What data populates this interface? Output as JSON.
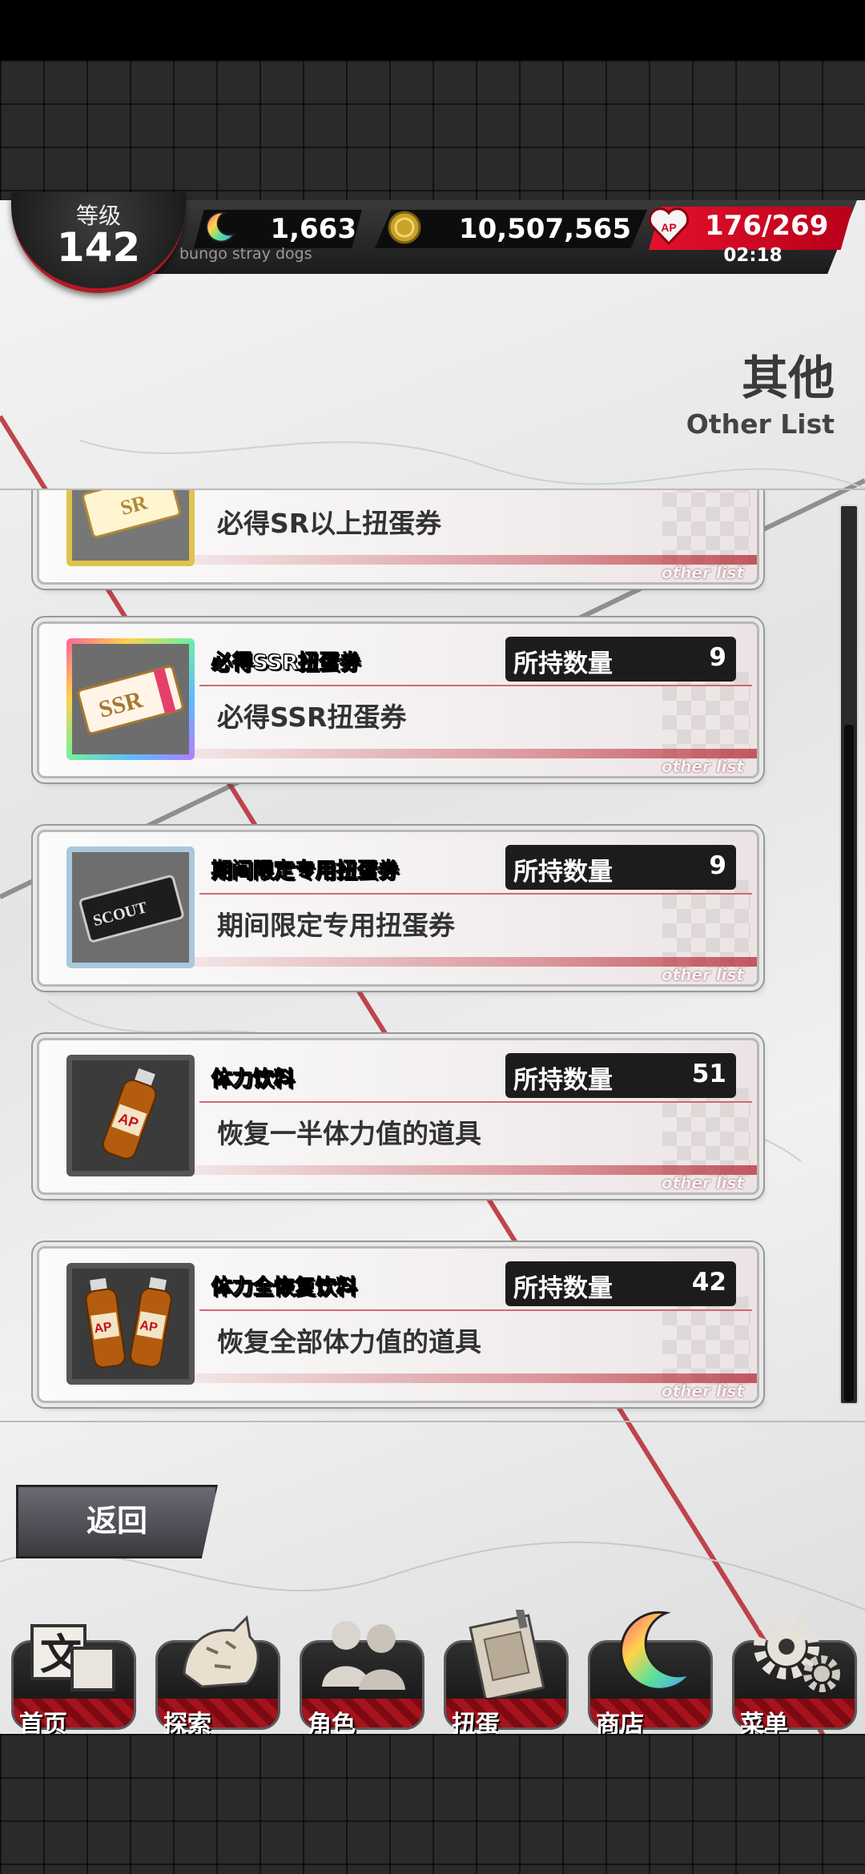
{
  "header": {
    "level_label": "等级",
    "level_value": "142",
    "crystal_count": "1,663",
    "coin_count": "10,507,565",
    "stamina_current": "176",
    "stamina_max": "/269",
    "stamina_timer": "02:18",
    "brand_text": "bungo stray dogs",
    "stamina_icon_text": "AP"
  },
  "page": {
    "title": "其他",
    "subtitle": "Other List"
  },
  "items": [
    {
      "title": "",
      "desc": "必得SR以上扭蛋券",
      "count_label": "",
      "count": "",
      "footer": "other list",
      "icon": "sr-ticket-icon",
      "thumb_text": "SR"
    },
    {
      "title": "必得SSR扭蛋券",
      "desc": "必得SSR扭蛋券",
      "count_label": "所持数量",
      "count": "9",
      "footer": "other list",
      "icon": "ssr-ticket-icon",
      "thumb_text": "SSR"
    },
    {
      "title": "期间限定专用扭蛋券",
      "desc": "期间限定专用扭蛋券",
      "count_label": "所持数量",
      "count": "9",
      "footer": "other list",
      "icon": "scout-ticket-icon",
      "thumb_text": "SCOUT"
    },
    {
      "title": "体力饮料",
      "desc": "恢复一半体力值的道具",
      "count_label": "所持数量",
      "count": "51",
      "footer": "other list",
      "icon": "energy-drink-icon",
      "thumb_text": "AP"
    },
    {
      "title": "体力全恢复饮料",
      "desc": "恢复全部体力值的道具",
      "count_label": "所持数量",
      "count": "42",
      "footer": "other list",
      "icon": "energy-drinks-icon",
      "thumb_text": "AP"
    }
  ],
  "back_button": "返回",
  "nav": [
    {
      "label": "首页",
      "icon": "home-icon",
      "icon_text": "文"
    },
    {
      "label": "探索",
      "icon": "explore-tiger-icon",
      "icon_text": ""
    },
    {
      "label": "角色",
      "icon": "characters-icon",
      "icon_text": ""
    },
    {
      "label": "扭蛋",
      "icon": "gacha-book-icon",
      "icon_text": ""
    },
    {
      "label": "商店",
      "icon": "shop-crystal-icon",
      "icon_text": ""
    },
    {
      "label": "菜单",
      "icon": "menu-gear-icon",
      "icon_text": ""
    }
  ],
  "colors": {
    "accent_red": "#c0121d",
    "stamina_red": "#e5112b",
    "frame_dark": "#2a2a2a"
  }
}
